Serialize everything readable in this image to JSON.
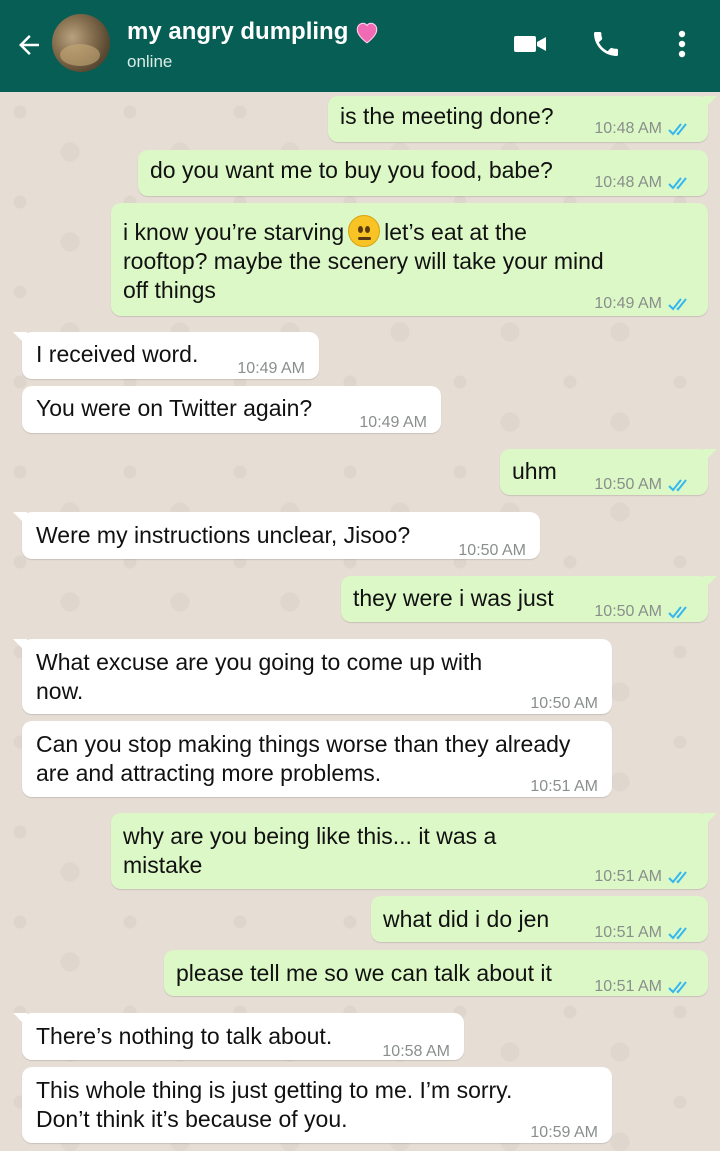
{
  "header": {
    "contact_name": "my angry dumpling",
    "status": "online",
    "heart_emoji": "💗"
  },
  "colors": {
    "header": "#075e54",
    "outgoing": "#dcf8c6",
    "incoming": "#ffffff",
    "read_tick": "#34b7f1"
  },
  "messages": [
    {
      "dir": "out",
      "lines": [
        "is the meeting done?"
      ],
      "time": "10:48 AM",
      "read": true
    },
    {
      "dir": "out",
      "lines": [
        "do you want me to buy you food, babe?"
      ],
      "time": "10:48 AM",
      "read": true
    },
    {
      "dir": "out",
      "lines": [
        "i know you’re starving",
        "let’s eat at the",
        "rooftop? maybe the scenery will take your mind",
        "off things"
      ],
      "time": "10:49 AM",
      "read": true,
      "emoji": "neutral-face"
    },
    {
      "dir": "in",
      "lines": [
        "I received word."
      ],
      "time": "10:49 AM"
    },
    {
      "dir": "in",
      "lines": [
        "You were on Twitter again?"
      ],
      "time": "10:49 AM"
    },
    {
      "dir": "out",
      "lines": [
        "uhm"
      ],
      "time": "10:50 AM",
      "read": true
    },
    {
      "dir": "in",
      "lines": [
        "Were my instructions unclear, Jisoo?"
      ],
      "time": "10:50 AM"
    },
    {
      "dir": "out",
      "lines": [
        "they were i was just"
      ],
      "time": "10:50 AM",
      "read": true
    },
    {
      "dir": "in",
      "lines": [
        "What excuse are you going to come up with",
        "now."
      ],
      "time": "10:50 AM"
    },
    {
      "dir": "in",
      "lines": [
        "Can you stop making things worse than they already",
        "are and attracting more problems."
      ],
      "time": "10:51 AM"
    },
    {
      "dir": "out",
      "lines": [
        "why are you being like this... it was a",
        "mistake"
      ],
      "time": "10:51 AM",
      "read": true
    },
    {
      "dir": "out",
      "lines": [
        "what did i do jen"
      ],
      "time": "10:51 AM",
      "read": true
    },
    {
      "dir": "out",
      "lines": [
        "please tell me so we can talk about it"
      ],
      "time": "10:51 AM",
      "read": true
    },
    {
      "dir": "in",
      "lines": [
        "There’s nothing to talk about."
      ],
      "time": "10:58 AM"
    },
    {
      "dir": "in",
      "lines": [
        "This whole thing is just getting to me. I’m sorry.",
        "Don’t think it’s because of you."
      ],
      "time": "10:59 AM"
    }
  ]
}
